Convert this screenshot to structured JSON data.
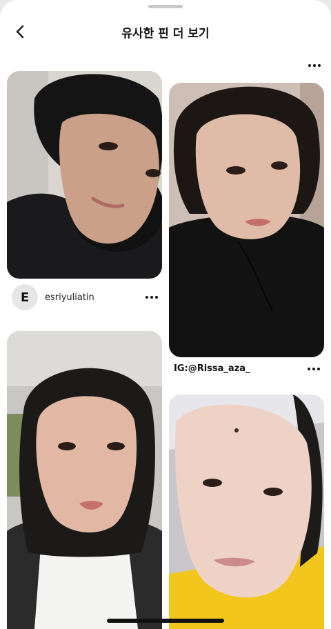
{
  "header": {
    "title": "유사한 핀 더 보기"
  },
  "pins": [
    {
      "id": "pin-1",
      "avatar_letter": "E",
      "username": "esriyuliatin"
    },
    {
      "id": "pin-2",
      "caption": "IG:@Rissa_aza_"
    },
    {
      "id": "pin-3"
    },
    {
      "id": "pin-4"
    }
  ],
  "colors": {
    "background": "#ffffff",
    "text": "#111111",
    "avatar_bg": "#e6e6e6"
  },
  "icons": [
    "chevron-left-icon",
    "more-horizontal-icon"
  ]
}
